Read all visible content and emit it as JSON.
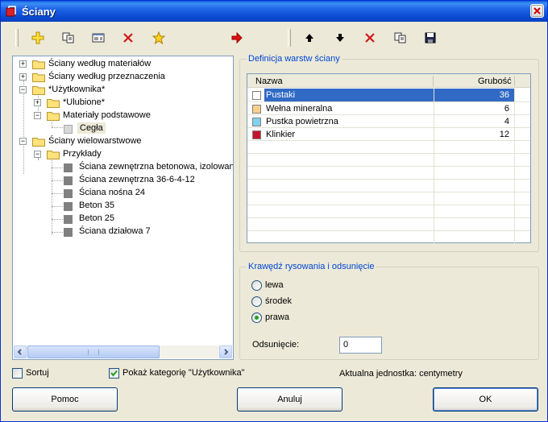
{
  "window": {
    "title": "Ściany"
  },
  "tree": {
    "items": [
      {
        "label": "Ściany według materiałów"
      },
      {
        "label": "Ściany według przeznaczenia"
      },
      {
        "label": "*Użytkownika*"
      },
      {
        "label": "*Ulubione*"
      },
      {
        "label": "Materiały podstawowe"
      },
      {
        "label": "Cegła"
      },
      {
        "label": "Ściany wielowarstwowe"
      },
      {
        "label": "Przykłady"
      },
      {
        "label": "Ściana zewnętrzna betonowa, izolowana"
      },
      {
        "label": "Ściana zewnętrzna 36-6-4-12"
      },
      {
        "label": "Ściana nośna 24"
      },
      {
        "label": "Beton 35"
      },
      {
        "label": "Beton 25"
      },
      {
        "label": "Ściana działowa 7"
      }
    ]
  },
  "layers": {
    "legend": "Definicja warstw ściany",
    "columns": {
      "name": "Nazwa",
      "thickness": "Grubość"
    },
    "rows": [
      {
        "name": "Pustaki",
        "thickness": "36",
        "color": "#FFFFFF"
      },
      {
        "name": "Wełna mineralna",
        "thickness": "6",
        "color": "#F6D08A"
      },
      {
        "name": "Pustka powietrzna",
        "thickness": "4",
        "color": "#7FD3F0"
      },
      {
        "name": "Klinkier",
        "thickness": "12",
        "color": "#C8102E"
      }
    ]
  },
  "edge": {
    "legend": "Krawędź rysowania i odsunięcie",
    "options": [
      "lewa",
      "środek",
      "prawa"
    ],
    "selected": "prawa",
    "offset_label": "Odsunięcie:",
    "offset_value": "0"
  },
  "footer": {
    "sort_label": "Sortuj",
    "show_user_label": "Pokaż kategorię \"Użytkownika\"",
    "unit_text": "Aktualna jednostka: centymetry"
  },
  "buttons": {
    "help": "Pomoc",
    "cancel": "Anuluj",
    "ok": "OK"
  },
  "icons": {
    "toolbar_left": [
      "new-icon",
      "copy-icon",
      "properties-icon",
      "delete-icon",
      "favorite-star-icon"
    ],
    "transfer": "transfer-arrow-icon",
    "toolbar_right": [
      "move-up-icon",
      "move-down-icon",
      "delete-layer-icon",
      "copy-layer-icon",
      "save-icon"
    ]
  }
}
